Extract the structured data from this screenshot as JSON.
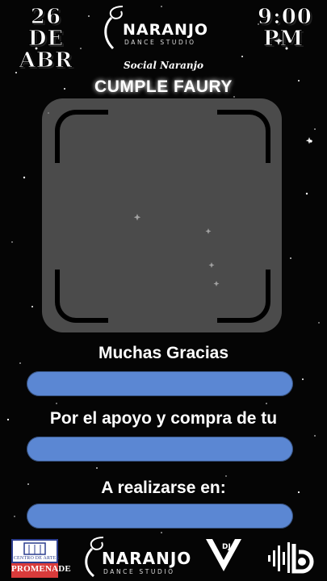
{
  "header": {
    "date_line1": "26 DE",
    "date_line2": "ABR",
    "time_line1": "9:00",
    "time_line2": "PM"
  },
  "brand": {
    "name": "NARANJO",
    "tagline": "DANCE STUDIO"
  },
  "event": {
    "series": "Social Naranjo",
    "title": "CUMPLE FAURY"
  },
  "messages": {
    "thanks": "Muchas Gracias",
    "support": "Por el apoyo y compra de tu",
    "venue": "A realizarse en:"
  },
  "footer": {
    "promenade_top": "CENTRO DE ARTES",
    "promenade_name": "PROMENADE",
    "dj_label": "DJ"
  },
  "colors": {
    "pill": "#5b87d3",
    "background": "#050505",
    "photo_frame": "#787878"
  }
}
